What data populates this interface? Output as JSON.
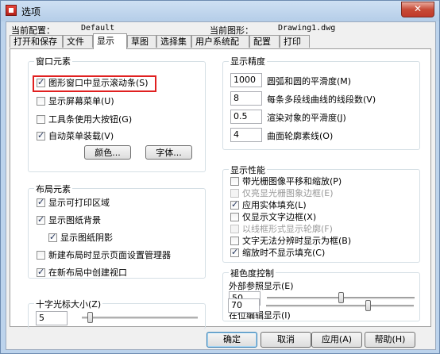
{
  "window": {
    "title": "选项",
    "close_label": "✕"
  },
  "config": {
    "current_profile_label": "当前配置：",
    "current_profile_value": "Default",
    "current_drawing_label": "当前图形：",
    "current_drawing_value": "Drawing1.dwg"
  },
  "tabs": [
    {
      "label": "打开和保存"
    },
    {
      "label": "文件"
    },
    {
      "label": "显示"
    },
    {
      "label": "草图"
    },
    {
      "label": "选择集"
    },
    {
      "label": "用户系统配置"
    },
    {
      "label": "配置"
    },
    {
      "label": "打印"
    }
  ],
  "window_elements": {
    "title": "窗口元素",
    "scrollbars": {
      "label": "图形窗口中显示滚动条(S)",
      "checked": true
    },
    "screen_menu": {
      "label": "显示屏幕菜单(U)",
      "checked": false
    },
    "large_buttons": {
      "label": "工具条使用大按钮(G)",
      "checked": false
    },
    "auto_menu": {
      "label": "自动菜单装载(V)",
      "checked": true
    },
    "colors_button": "颜色...",
    "fonts_button": "字体..."
  },
  "layout_elements": {
    "title": "布局元素",
    "printable_area": {
      "label": "显示可打印区域",
      "checked": true
    },
    "paper_background": {
      "label": "显示图纸背景",
      "checked": true
    },
    "paper_shadow": {
      "label": "显示图纸阴影",
      "checked": true
    },
    "page_setup": {
      "label": "新建布局时显示页面设置管理器",
      "checked": false
    },
    "create_viewport": {
      "label": "在新布局中创建视口",
      "checked": true
    }
  },
  "crosshair": {
    "title": "十字光标大小(Z)",
    "value": "5",
    "slider_fraction": 0.05
  },
  "display_resolution": {
    "title": "显示精度",
    "rows": [
      {
        "value": "1000",
        "label": "圆弧和圆的平滑度(M)"
      },
      {
        "value": "8",
        "label": "每条多段线曲线的线段数(V)"
      },
      {
        "value": "0.5",
        "label": "渲染对象的平滑度(J)"
      },
      {
        "value": "4",
        "label": "曲面轮廓素线(O)"
      }
    ]
  },
  "display_performance": {
    "title": "显示性能",
    "items": [
      {
        "label": "带光栅图像平移和缩放(P)",
        "checked": false,
        "disabled": false
      },
      {
        "label": "仅亮显光栅图象边框(E)",
        "checked": false,
        "disabled": true
      },
      {
        "label": "应用实体填充(L)",
        "checked": true,
        "disabled": false
      },
      {
        "label": "仅显示文字边框(X)",
        "checked": false,
        "disabled": false
      },
      {
        "label": "以线框形式显示轮廓(F)",
        "checked": false,
        "disabled": true
      },
      {
        "label": "文字无法分辨时显示为框(B)",
        "checked": false,
        "disabled": false
      },
      {
        "label": "缩放时不显示填充(C)",
        "checked": true,
        "disabled": false
      }
    ]
  },
  "fade_control": {
    "title": "褪色度控制",
    "xref": {
      "label": "外部参照显示(E)",
      "value": "50",
      "slider_fraction": 0.5
    },
    "inplace": {
      "label": "在位编辑显示(I)",
      "value": "70",
      "slider_fraction": 0.7
    }
  },
  "footer": {
    "ok": "确定",
    "cancel": "取消",
    "apply": "应用(A)",
    "help": "帮助(H)"
  }
}
